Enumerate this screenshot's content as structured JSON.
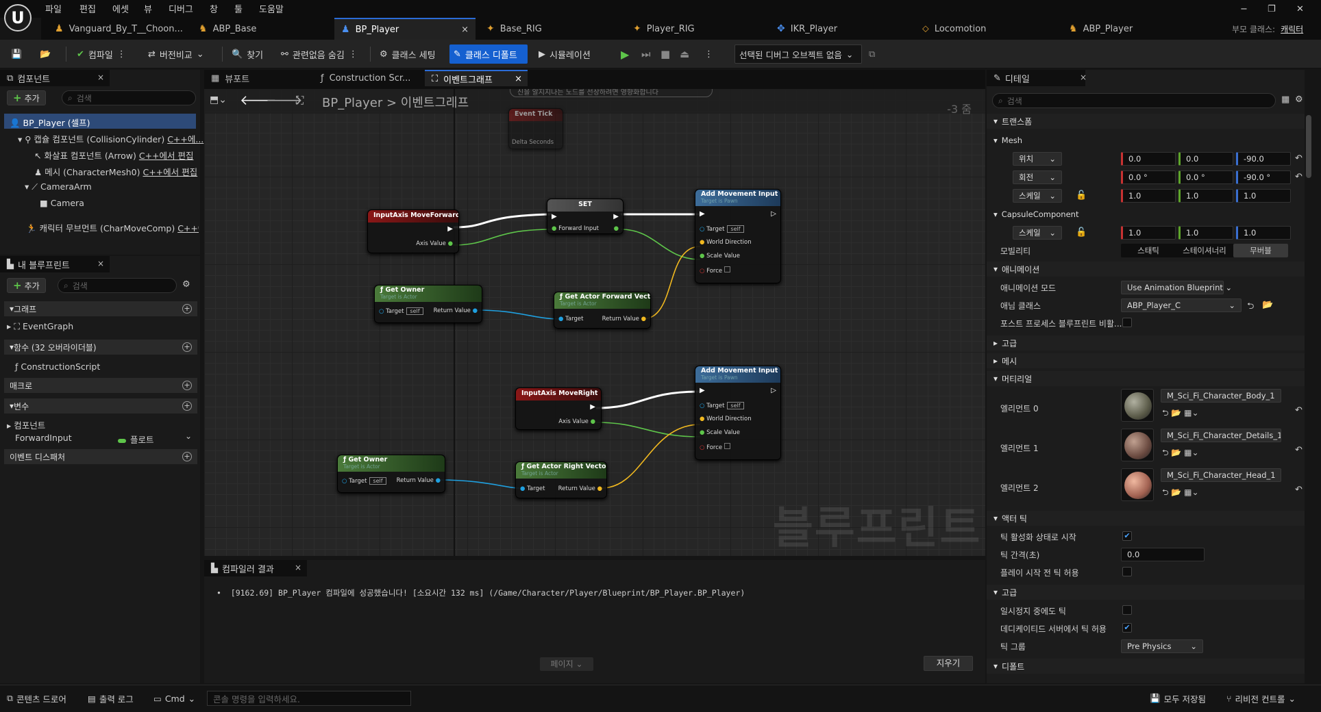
{
  "menu": [
    "파일",
    "편집",
    "에셋",
    "뷰",
    "디버그",
    "창",
    "툴",
    "도움말"
  ],
  "window_controls": {
    "min": "−",
    "restore": "❐",
    "close": "✕"
  },
  "tabs": [
    {
      "label": "Vanguard_By_T__Choon...",
      "icon": "character-icon"
    },
    {
      "label": "ABP_Base",
      "icon": "anim-icon"
    },
    {
      "label": "BP_Player",
      "icon": "blueprint-icon"
    },
    {
      "label": "Base_RIG",
      "icon": "rig-icon"
    },
    {
      "label": "Player_RIG",
      "icon": "rig-icon"
    },
    {
      "label": "IKR_Player",
      "icon": "ik-icon"
    },
    {
      "label": "Locomotion",
      "icon": "blendspace-icon"
    },
    {
      "label": "ABP_Player",
      "icon": "anim-icon"
    }
  ],
  "tab_close": "×",
  "parent_class": {
    "label": "부모 클래스:",
    "value": "캐릭터"
  },
  "toolbar": {
    "compile": "컴파일",
    "diff": "버전비교",
    "find": "찾기",
    "hide_unrelated": "관련없음 숨김",
    "class_settings": "클래스 세팅",
    "class_defaults": "클래스 디폴트",
    "simulation": "시뮬레이션",
    "debug_object": "선택된 디버그 오브젝트 없음"
  },
  "components": {
    "title": "컴포넌트",
    "add": "추가",
    "search_placeholder": "검색",
    "self": "BP_Player (셀프)",
    "items": [
      {
        "name": "캡슐 컴포넌트 (CollisionCylinder)",
        "link": "C++에..."
      },
      {
        "name": "화살표 컴포넌트 (Arrow)",
        "link": "C++에서 편집"
      },
      {
        "name": "메시 (CharacterMesh0)",
        "link": "C++에서 편집"
      },
      {
        "name": "CameraArm",
        "link": ""
      },
      {
        "name": "Camera",
        "link": ""
      },
      {
        "name": "캐릭터 무브먼트 (CharMoveComp)",
        "link": "C++에"
      }
    ]
  },
  "my_blueprint": {
    "title": "내 블루프린트",
    "add": "추가",
    "search_placeholder": "검색",
    "graph_section": "그래프",
    "event_graph": "EventGraph",
    "functions_section": "함수 (32 오버라이더블)",
    "construction_script": "ConstructionScript",
    "macros_section": "매크로",
    "variables_section": "변수",
    "components_sub": "컴포넌트",
    "variable_name": "ForwardInput",
    "variable_type": "플로트",
    "dispatchers_section": "이벤트 디스패처"
  },
  "graph_tabs": [
    {
      "label": "뷰포트",
      "icon": "viewport-icon"
    },
    {
      "label": "Construction Scr...",
      "icon": "function-icon"
    },
    {
      "label": "이벤트그래프",
      "icon": "graph-icon"
    }
  ],
  "breadcrumb": {
    "root": "BP_Player",
    "sep": ">",
    "current": "이벤트그래프"
  },
  "zoom_level": "-3 줌",
  "graph_hint": "신을 알지지나는 노드를 선상하려면 영향화합니다",
  "watermark": "블루프린트",
  "nodes": {
    "event_tick": {
      "title": "Event Tick",
      "pin": "Delta Seconds"
    },
    "move_forward": {
      "title": "InputAxis MoveForward",
      "pin": "Axis Value"
    },
    "set": {
      "title": "SET",
      "pin": "Forward Input"
    },
    "add_move_1": {
      "title": "Add Movement Input",
      "sub": "Target is Pawn",
      "pins": [
        "Target",
        "World Direction",
        "Scale Value",
        "Force"
      ],
      "self": "self"
    },
    "get_owner_1": {
      "title": "Get Owner",
      "sub": "Target is Actor",
      "target": "Target",
      "self": "self",
      "ret": "Return Value"
    },
    "fwd_vector": {
      "title": "Get Actor Forward Vector",
      "sub": "Target is Actor",
      "target": "Target",
      "ret": "Return Value"
    },
    "move_right": {
      "title": "InputAxis MoveRight",
      "pin": "Axis Value"
    },
    "add_move_2": {
      "title": "Add Movement Input",
      "sub": "Target is Pawn",
      "pins": [
        "Target",
        "World Direction",
        "Scale Value",
        "Force"
      ],
      "self": "self"
    },
    "get_owner_2": {
      "title": "Get Owner",
      "sub": "Target is Actor",
      "target": "Target",
      "self": "self",
      "ret": "Return Value"
    },
    "right_vector": {
      "title": "Get Actor Right Vector",
      "sub": "Target is Actor",
      "target": "Target",
      "ret": "Return Value"
    }
  },
  "compiler": {
    "title": "컴파일러 결과",
    "message": "[9162.69] BP_Player 컴파일에 성공했습니다! [소요시간 132 ms] (/Game/Character/Player/Blueprint/BP_Player.BP_Player)",
    "page": "페이지",
    "clear": "지우기"
  },
  "details": {
    "title": "디테일",
    "search_placeholder": "검색",
    "transform": "트랜스폼",
    "mesh_sub": "Mesh",
    "location": {
      "label": "위치",
      "x": "0.0",
      "y": "0.0",
      "z": "-90.0"
    },
    "rotation": {
      "label": "회전",
      "x": "0.0 °",
      "y": "0.0 °",
      "z": "-90.0 °"
    },
    "scale": {
      "label": "스케일",
      "x": "1.0",
      "y": "1.0",
      "z": "1.0"
    },
    "capsule_sub": "CapsuleComponent",
    "capsule_scale": {
      "label": "스케일",
      "x": "1.0",
      "y": "1.0",
      "z": "1.0"
    },
    "mobility": {
      "label": "모빌리티",
      "options": [
        "스태틱",
        "스테이셔너리",
        "무버블"
      ]
    },
    "animation": "애니메이션",
    "anim_mode": {
      "label": "애니메이션 모드",
      "value": "Use Animation Blueprint"
    },
    "anim_class": {
      "label": "애님 클래스",
      "value": "ABP_Player_C"
    },
    "post_process": {
      "label": "포스트 프로세스 블루프린트 비활..."
    },
    "advanced": "고급",
    "mesh": "메시",
    "materials": "머티리얼",
    "elements": [
      {
        "label": "엘리먼트 0",
        "value": "M_Sci_Fi_Character_Body_1",
        "color": "#6b6b55"
      },
      {
        "label": "엘리먼트 1",
        "value": "M_Sci_Fi_Character_Details_1",
        "color": "#7a5a50"
      },
      {
        "label": "엘리먼트 2",
        "value": "M_Sci_Fi_Character_Head_1",
        "color": "#b07060"
      }
    ],
    "actor_tick": "액터 틱",
    "start_tick": {
      "label": "틱 활성화 상태로 시작"
    },
    "tick_interval": {
      "label": "틱 간격(초)",
      "value": "0.0"
    },
    "tick_before_play": {
      "label": "플레이 시작 전 틱 허용"
    },
    "advanced2": "고급",
    "tick_paused": {
      "label": "일시정지 중에도 틱"
    },
    "dedicated_tick": {
      "label": "데디케이티드 서버에서 틱 허용"
    },
    "tick_group": {
      "label": "틱 그룹",
      "value": "Pre Physics"
    },
    "defaults": "디폴트"
  },
  "statusbar": {
    "content_drawer": "콘텐츠 드로어",
    "output_log": "출력 로그",
    "cmd": "Cmd",
    "console_placeholder": "콘솔 명령을 입력하세요.",
    "save_all": "모두 저장됨",
    "revision": "리비전 컨트롤"
  },
  "colors": {
    "accent": "#1560d0",
    "exec": "#ffffff",
    "float_pin": "#5ec54a",
    "vector_pin": "#f0b820",
    "object_pin": "#1fa0e0"
  }
}
